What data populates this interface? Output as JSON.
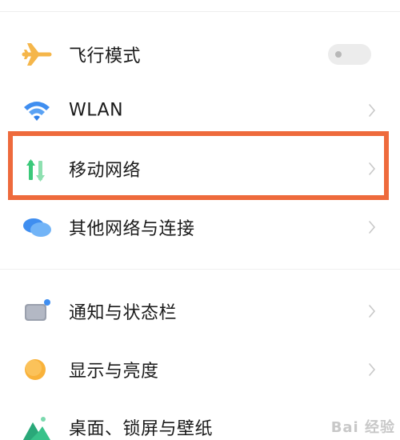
{
  "settings": {
    "items": [
      {
        "label": "飞行模式",
        "icon": "airplane-icon",
        "control": "toggle",
        "toggle_on": false
      },
      {
        "label": "WLAN",
        "icon": "wifi-icon",
        "control": "chevron"
      },
      {
        "label": "移动网络",
        "icon": "mobile-data-icon",
        "control": "chevron",
        "highlighted": true
      },
      {
        "label": "其他网络与连接",
        "icon": "cloud-connection-icon",
        "control": "chevron"
      },
      {
        "label": "通知与状态栏",
        "icon": "notification-icon",
        "control": "chevron"
      },
      {
        "label": "显示与亮度",
        "icon": "brightness-icon",
        "control": "chevron"
      },
      {
        "label": "桌面、锁屏与壁纸",
        "icon": "wallpaper-icon",
        "control": "chevron"
      }
    ]
  },
  "highlight_color": "#ee6a3c",
  "watermark": "Bai 经验"
}
